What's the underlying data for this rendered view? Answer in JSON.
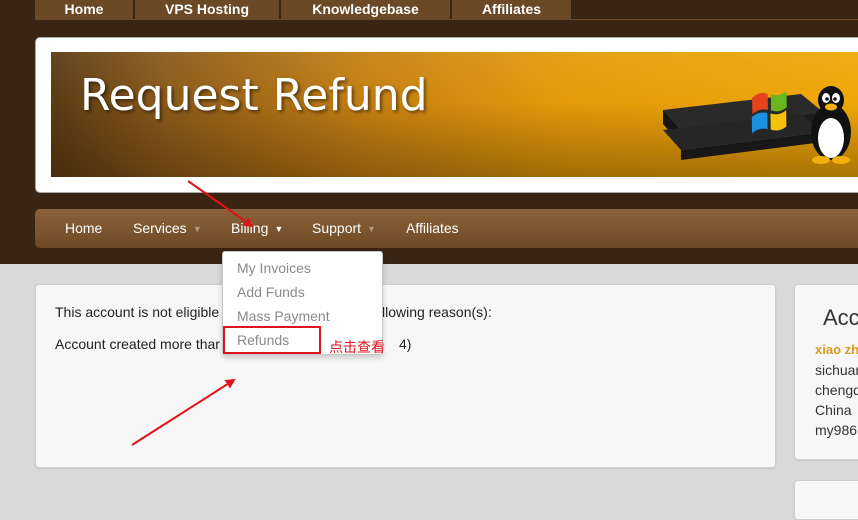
{
  "top_nav": {
    "items": [
      {
        "label": "Home"
      },
      {
        "label": "VPS Hosting"
      },
      {
        "label": "Knowledgebase"
      },
      {
        "label": "Affiliates"
      }
    ]
  },
  "banner": {
    "title": "Request Refund"
  },
  "main_nav": {
    "items": [
      {
        "label": "Home"
      },
      {
        "label": "Services"
      },
      {
        "label": "Billing"
      },
      {
        "label": "Support"
      },
      {
        "label": "Affiliates"
      }
    ]
  },
  "billing_dropdown": {
    "items": [
      {
        "label": "My Invoices"
      },
      {
        "label": "Add Funds"
      },
      {
        "label": "Mass Payment"
      },
      {
        "label": "Refunds"
      }
    ]
  },
  "annotation": {
    "text": "点击查看"
  },
  "content": {
    "line1_start": "This account is not eligible",
    "line1_end": "llowing reason(s):",
    "line2_start": "Account created more thar",
    "line2_end": "4)"
  },
  "sidebar": {
    "title": "Acc",
    "name": "xiao zh",
    "lines": [
      "sichuar",
      "chengd",
      "China",
      "my986"
    ]
  },
  "colors": {
    "header_bg": "#3a2413",
    "nav_bg": "#7a5430",
    "accent_orange": "#f0a808",
    "annotation_red": "#e0121a"
  }
}
